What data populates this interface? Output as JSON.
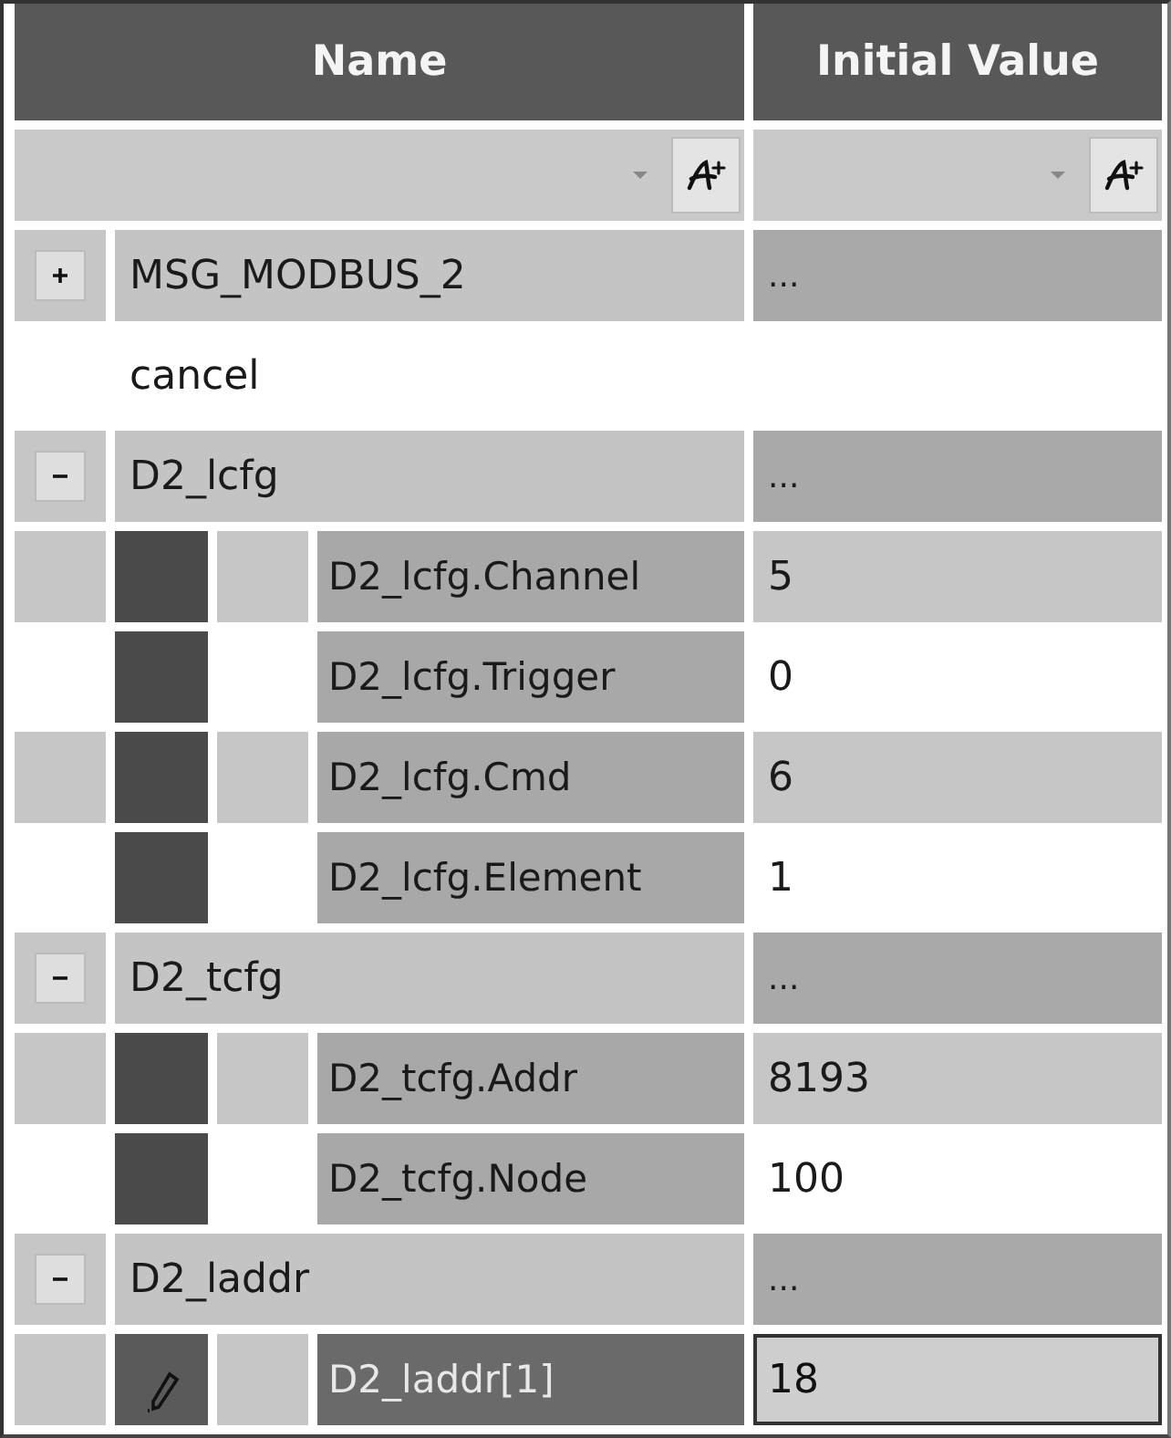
{
  "columns": [
    {
      "label": "Name"
    },
    {
      "label": "Initial Value"
    }
  ],
  "rows": [
    {
      "kind": "group",
      "name": "MSG_MODBUS_2",
      "value": "...",
      "expanded": false,
      "children": []
    },
    {
      "kind": "plain",
      "name": "cancel"
    },
    {
      "kind": "group",
      "name": "D2_lcfg",
      "value": "...",
      "expanded": true,
      "children": [
        {
          "name": "D2_lcfg.Channel",
          "value": "5",
          "selected": false
        },
        {
          "name": "D2_lcfg.Trigger",
          "value": "0",
          "selected": false
        },
        {
          "name": "D2_lcfg.Cmd",
          "value": "6",
          "selected": false
        },
        {
          "name": "D2_lcfg.Element",
          "value": "1",
          "selected": false
        }
      ]
    },
    {
      "kind": "group",
      "name": "D2_tcfg",
      "value": "...",
      "expanded": true,
      "children": [
        {
          "name": "D2_tcfg.Addr",
          "value": "8193",
          "selected": false
        },
        {
          "name": "D2_tcfg.Node",
          "value": "100",
          "selected": false
        }
      ]
    },
    {
      "kind": "group",
      "name": "D2_laddr",
      "value": "...",
      "expanded": true,
      "children": [
        {
          "name": "D2_laddr[1]",
          "value": "18",
          "selected": true
        }
      ]
    }
  ]
}
